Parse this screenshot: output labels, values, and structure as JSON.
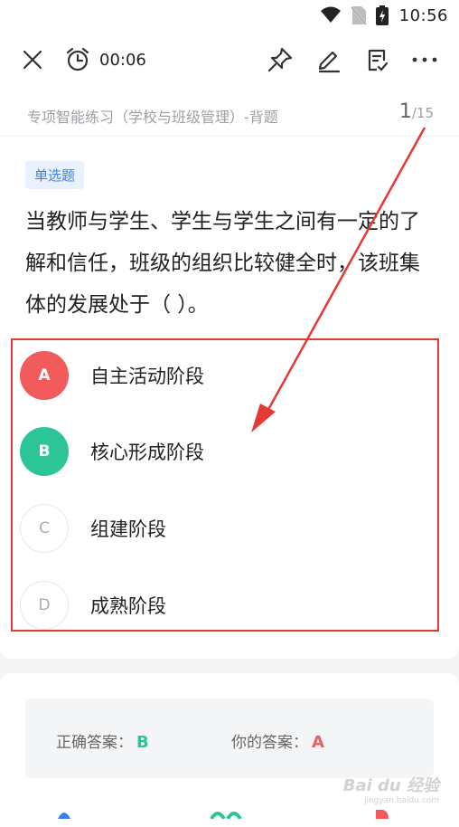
{
  "status_bar": {
    "time": "10:56"
  },
  "toolbar": {
    "timer": "00:06"
  },
  "header": {
    "subtitle": "专项智能练习（学校与班级管理）-背题",
    "progress_current": "1",
    "progress_total": "/15"
  },
  "question": {
    "type_badge": "单选题",
    "text": "当教师与学生、学生与学生之间有一定的了解和信任，班级的组织比较健全时，该班集体的发展处于（    ）。",
    "options": [
      {
        "letter": "A",
        "text": "自主活动阶段",
        "state": "wrong"
      },
      {
        "letter": "B",
        "text": "核心形成阶段",
        "state": "right"
      },
      {
        "letter": "C",
        "text": "组建阶段",
        "state": "plain"
      },
      {
        "letter": "D",
        "text": "成熟阶段",
        "state": "plain"
      }
    ]
  },
  "answer": {
    "correct_label": "正确答案：",
    "correct_value": "B",
    "yours_label": "你的答案：",
    "yours_value": "A"
  },
  "watermark": {
    "text": "Bai du 经验",
    "sub": "jingyan.baidu.com"
  },
  "colors": {
    "wrong": "#f25b5b",
    "right": "#2cc597",
    "annotation": "#e53935",
    "badge": "#3b82e6"
  }
}
